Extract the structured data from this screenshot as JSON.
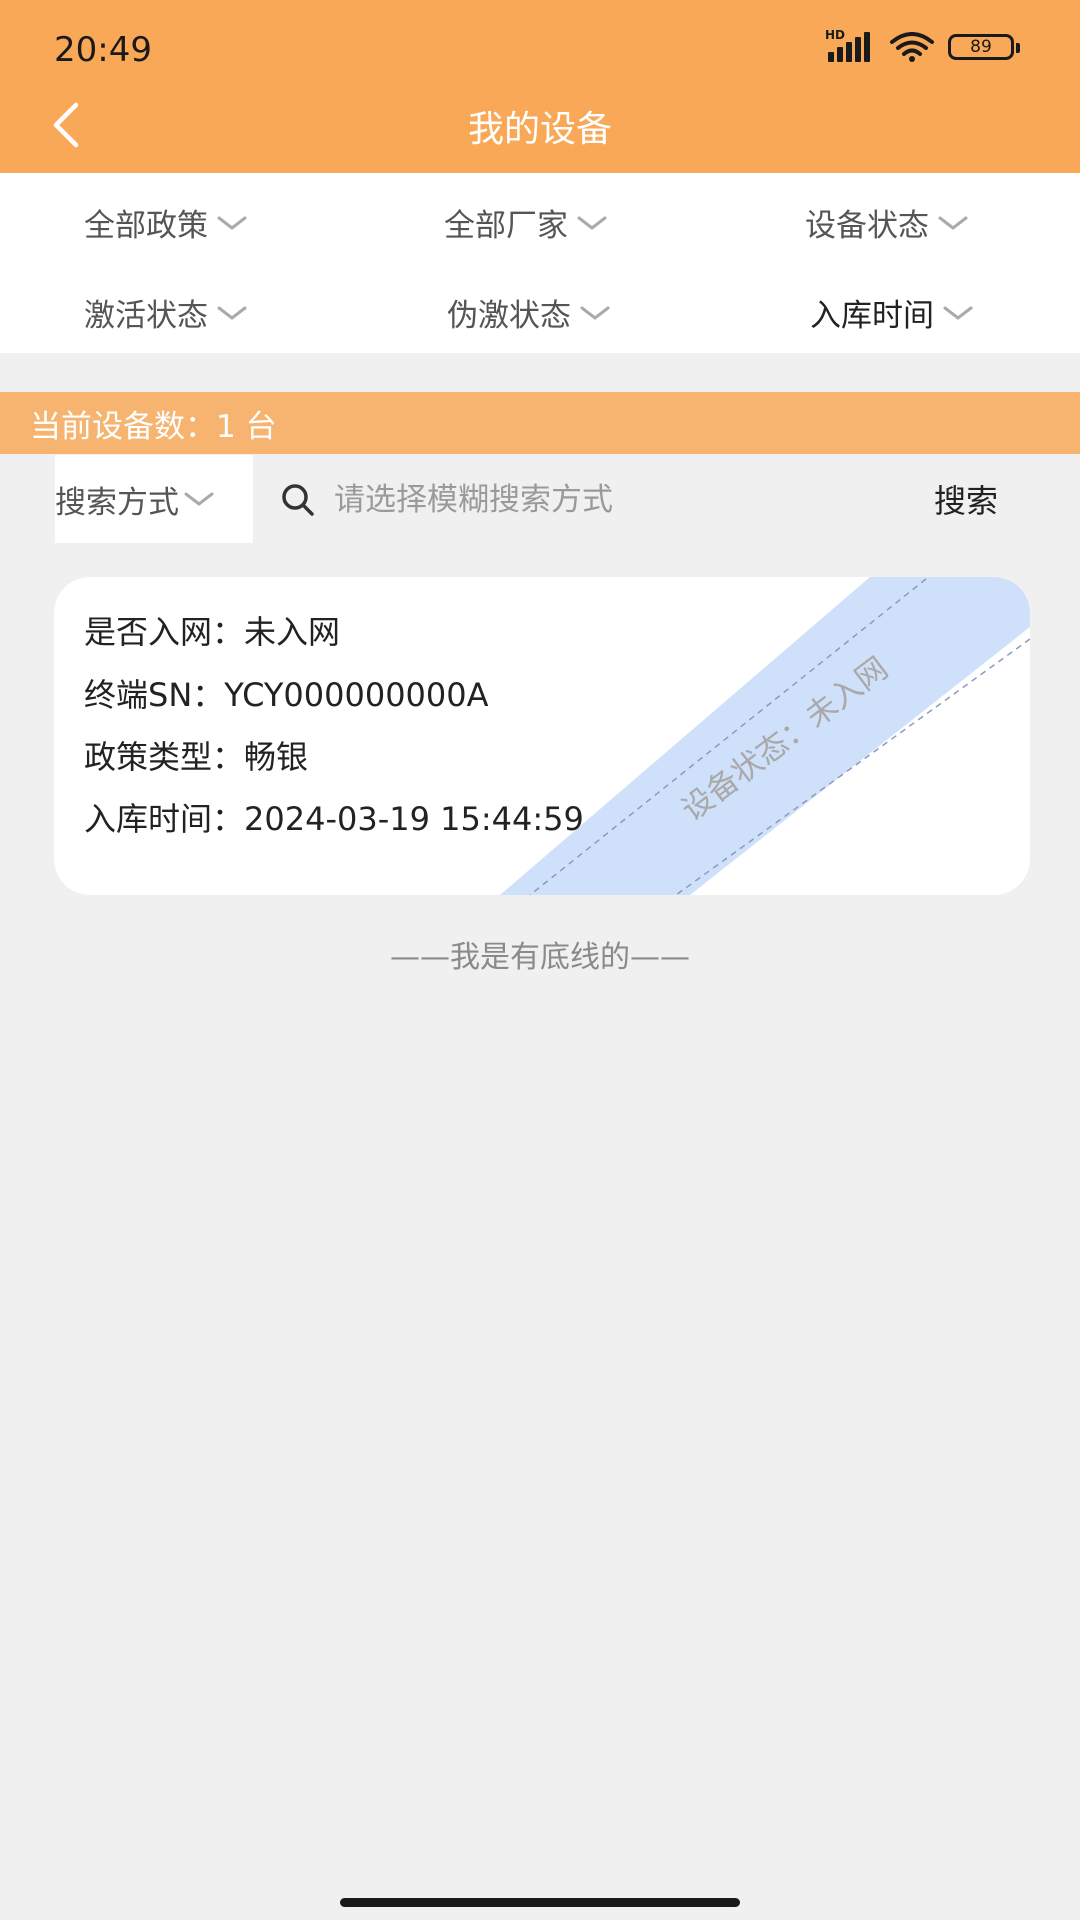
{
  "status_bar": {
    "time": "20:49",
    "network": "HD",
    "battery": "89"
  },
  "header": {
    "title": "我的设备"
  },
  "filters": {
    "policy": "全部政策",
    "vendor": "全部厂家",
    "device_status": "设备状态",
    "activation_status": "激活状态",
    "fake_activation_status": "伪激状态",
    "stock_time": "入库时间"
  },
  "count_bar": {
    "text": "当前设备数：1 台"
  },
  "search": {
    "mode_label": "搜索方式",
    "placeholder": "请选择模糊搜索方式",
    "button_label": "搜索"
  },
  "device_card": {
    "network_label": "是否入网：",
    "network_value": "未入网",
    "sn_label": "终端SN：",
    "sn_value": "YCY000000000A",
    "policy_label": "政策类型：",
    "policy_value": "畅银",
    "stock_label": "入库时间：",
    "stock_value": "2024-03-19 15:44:59",
    "ribbon_text": "设备状态：未入网"
  },
  "footer": {
    "bottom_line": "——我是有底线的——"
  },
  "colors": {
    "brand_orange": "#f9a857",
    "count_bar": "#f6b470",
    "ribbon_blue": "#cfe0fb",
    "page_bg": "#f0f0f0"
  }
}
